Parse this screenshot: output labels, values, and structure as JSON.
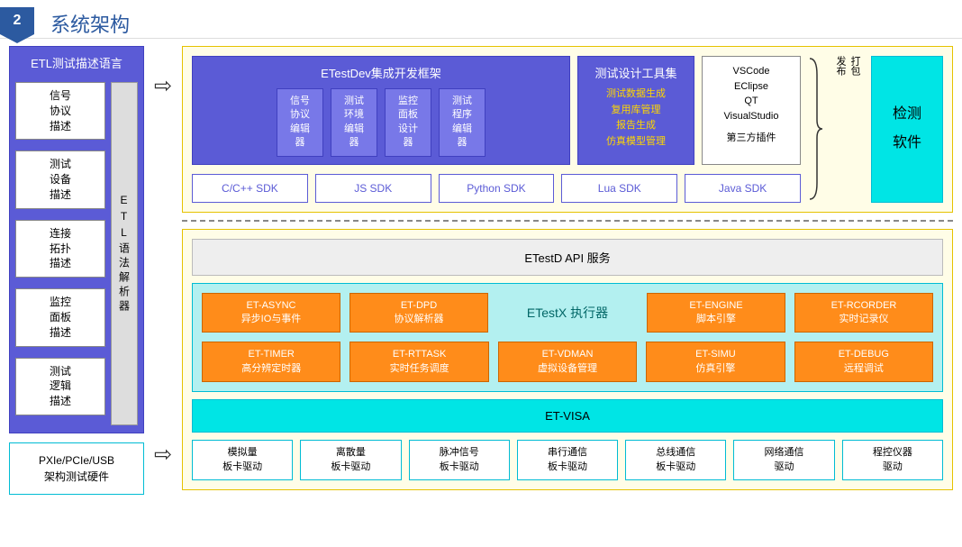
{
  "header": {
    "num": "2",
    "title": "系统架构"
  },
  "etl": {
    "title": "ETL测试描述语言",
    "items": [
      "信号\n协议\n描述",
      "测试\n设备\n描述",
      "连接\n拓扑\n描述",
      "监控\n面板\n描述",
      "测试\n逻辑\n描述"
    ],
    "parser": "ETL语法解析器"
  },
  "hw": "PXIe/PCIe/USB\n架构测试硬件",
  "dev": {
    "title": "ETestDev集成开发框架",
    "items": [
      "信号\n协议\n编辑\n器",
      "测试\n环境\n编辑\n器",
      "监控\n面板\n设计\n器",
      "测试\n程序\n编辑\n器"
    ]
  },
  "tools": {
    "title": "测试设计工具集",
    "items": [
      "测试数据生成",
      "复用库管理",
      "报告生成",
      "仿真模型管理"
    ]
  },
  "ide": {
    "lines": [
      "VSCode",
      "EClipse",
      "QT",
      "VisualStudio"
    ],
    "plugin": "第三方插件"
  },
  "publish": "打包\n发布",
  "detect": [
    "检测",
    "软件"
  ],
  "sdks": [
    "C/C++ SDK",
    "JS SDK",
    "Python SDK",
    "Lua SDK",
    "Java SDK"
  ],
  "api": "ETestD API 服务",
  "exec": {
    "label": "ETestX 执行器",
    "row1": [
      {
        "t": "ET-ASYNC",
        "s": "异步IO与事件"
      },
      {
        "t": "ET-DPD",
        "s": "协议解析器"
      },
      {
        "t": "",
        "s": ""
      },
      {
        "t": "ET-ENGINE",
        "s": "脚本引擎"
      },
      {
        "t": "ET-RCORDER",
        "s": "实时记录仪"
      }
    ],
    "row2": [
      {
        "t": "ET-TIMER",
        "s": "高分辨定时器"
      },
      {
        "t": "ET-RTTASK",
        "s": "实时任务调度"
      },
      {
        "t": "ET-VDMAN",
        "s": "虚拟设备管理"
      },
      {
        "t": "ET-SIMU",
        "s": "仿真引擎"
      },
      {
        "t": "ET-DEBUG",
        "s": "远程调试"
      }
    ]
  },
  "visa": "ET-VISA",
  "drivers": [
    {
      "t": "模拟量",
      "s": "板卡驱动"
    },
    {
      "t": "离散量",
      "s": "板卡驱动"
    },
    {
      "t": "脉冲信号",
      "s": "板卡驱动"
    },
    {
      "t": "串行通信",
      "s": "板卡驱动"
    },
    {
      "t": "总线通信",
      "s": "板卡驱动"
    },
    {
      "t": "网络通信",
      "s": "驱动"
    },
    {
      "t": "程控仪器",
      "s": "驱动"
    }
  ]
}
